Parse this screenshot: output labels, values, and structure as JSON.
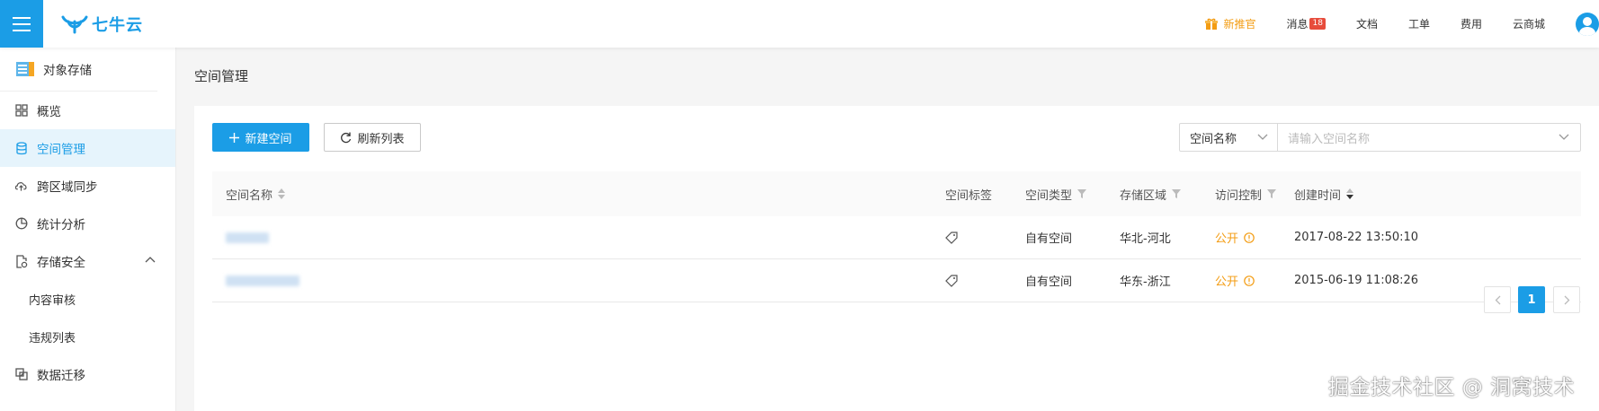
{
  "topbar": {
    "logo_text": "七牛云",
    "nav": {
      "promo": "新推官",
      "messages": "消息",
      "messages_badge": "18",
      "docs": "文档",
      "tickets": "工单",
      "billing": "费用",
      "marketplace": "云商城"
    }
  },
  "sidebar": {
    "header": "对象存储",
    "items": [
      {
        "label": "概览",
        "icon": "grid-icon"
      },
      {
        "label": "空间管理",
        "icon": "database-icon"
      },
      {
        "label": "跨区域同步",
        "icon": "cloud-sync-icon"
      },
      {
        "label": "统计分析",
        "icon": "pie-chart-icon"
      },
      {
        "label": "存储安全",
        "icon": "shield-doc-icon"
      },
      {
        "label": "内容审核"
      },
      {
        "label": "违规列表"
      },
      {
        "label": "数据迁移",
        "icon": "migrate-icon"
      }
    ]
  },
  "main": {
    "page_title": "空间管理",
    "toolbar": {
      "create_label": "新建空间",
      "refresh_label": "刷新列表"
    },
    "search": {
      "field_selected": "空间名称",
      "placeholder": "请输入空间名称"
    },
    "table": {
      "columns": [
        "空间名称",
        "空间标签",
        "空间类型",
        "存储区域",
        "访问控制",
        "创建时间"
      ],
      "rows": [
        {
          "type": "自有空间",
          "region": "华北-河北",
          "access": "公开",
          "created": "2017-08-22 13:50:10"
        },
        {
          "type": "自有空间",
          "region": "华东-浙江",
          "access": "公开",
          "created": "2015-06-19 11:08:26"
        }
      ]
    },
    "pagination": {
      "current": "1"
    }
  },
  "watermark": "掘金技术社区 @ 洞窝技术",
  "colors": {
    "accent": "#1b9de6",
    "warning": "#f39c12",
    "badge": "#e74c3c"
  }
}
